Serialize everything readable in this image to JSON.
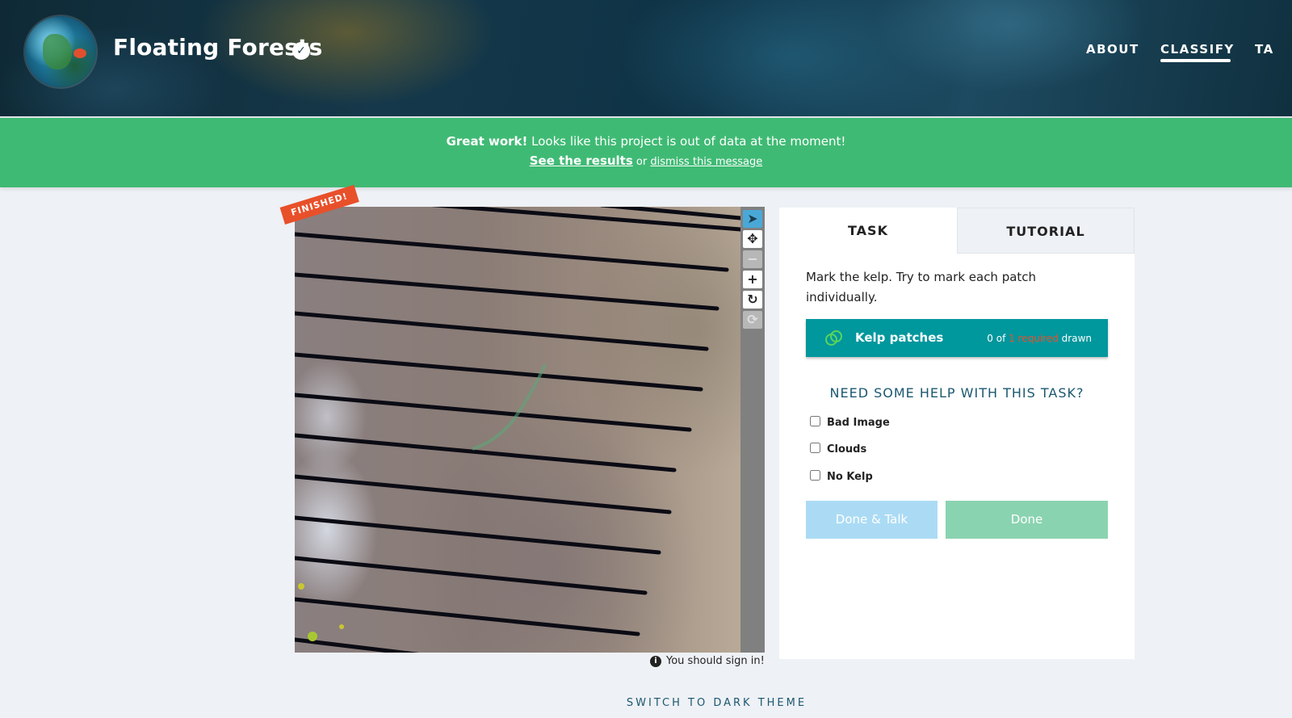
{
  "header": {
    "project_title": "Floating Forests",
    "verified_icon": "check-circle-icon",
    "nav": [
      {
        "label": "ABOUT"
      },
      {
        "label": "CLASSIFY"
      },
      {
        "label": "TA"
      }
    ]
  },
  "banner": {
    "bold": "Great work!",
    "message": " Looks like this project is out of data at the moment!",
    "results_link": "See the results",
    "or_text": " or ",
    "dismiss_link": "dismiss this message",
    "color": "#3fba74"
  },
  "subject": {
    "finished_badge": "FINISHED!",
    "sign_in_text": "You should sign in!",
    "tools": [
      "pointer-icon",
      "move-icon",
      "zoom-out-icon",
      "zoom-in-icon",
      "rotate-icon",
      "reset-icon"
    ]
  },
  "panel": {
    "tabs": [
      {
        "label": "TASK"
      },
      {
        "label": "TUTORIAL"
      }
    ],
    "instructions": "Mark the kelp. Try to mark each patch individually.",
    "tool": {
      "label": "Kelp patches",
      "count_prefix": "0 of ",
      "count_required": "1 required",
      "count_suffix": " drawn",
      "color": "#00979d"
    },
    "help_heading": "NEED SOME HELP WITH THIS TASK?",
    "options": [
      {
        "label": "Bad Image",
        "checked": false
      },
      {
        "label": "Clouds",
        "checked": false
      },
      {
        "label": "No Kelp",
        "checked": false
      }
    ],
    "done_talk_label": "Done & Talk",
    "done_label": "Done"
  },
  "footer": {
    "switch_theme": "SWITCH TO DARK THEME"
  }
}
